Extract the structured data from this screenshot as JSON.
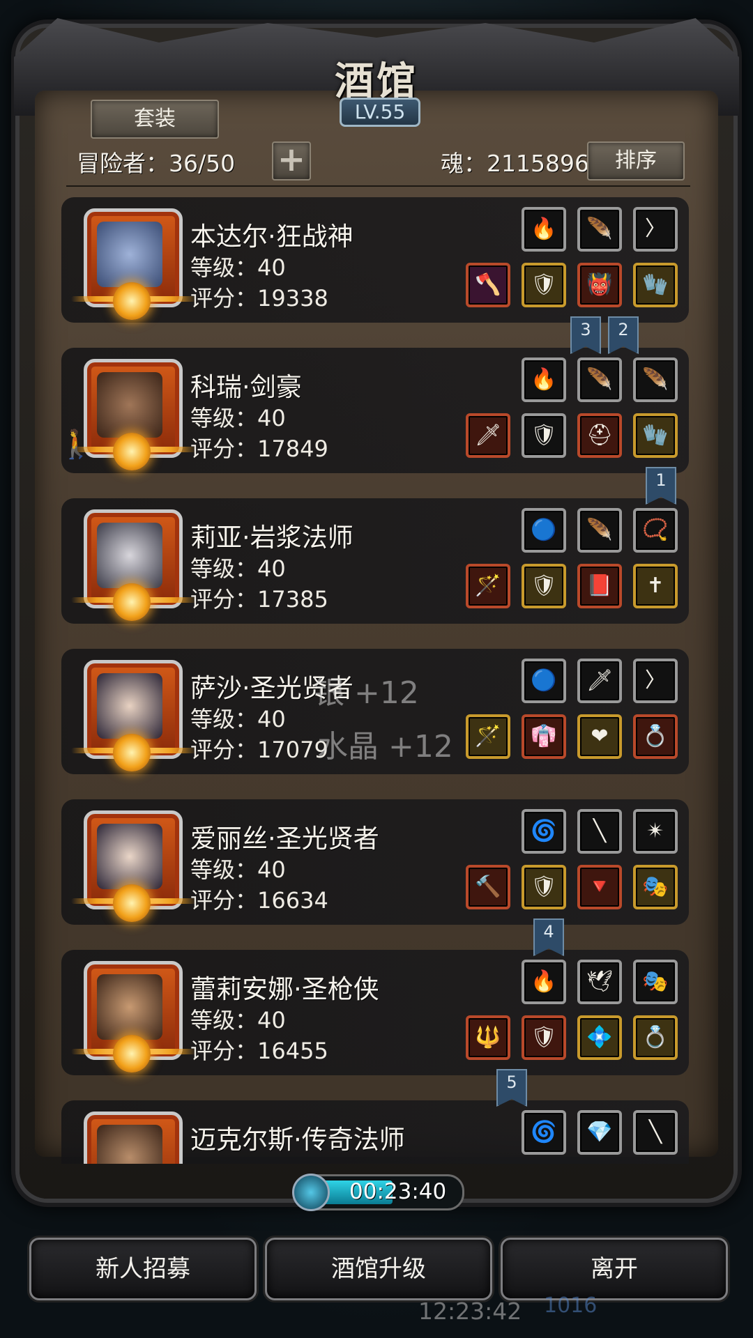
{
  "header": {
    "title": "酒馆",
    "level": "LV.55"
  },
  "toolbar": {
    "set_label": "套装",
    "adventurer_count": "冒险者：36/50",
    "plus_label": "+",
    "soul_value": "魂：2115896",
    "sort_label": "排序"
  },
  "heroes": [
    {
      "name": "本达尔·狂战神",
      "level": "等级：40",
      "score": "评分：19338"
    },
    {
      "name": "科瑞·剑豪",
      "level": "等级：40",
      "score": "评分：17849"
    },
    {
      "name": "莉亚·岩浆法师",
      "level": "等级：40",
      "score": "评分：17385"
    },
    {
      "name": "萨沙·圣光贤者",
      "level": "等级：40",
      "score": "评分：17079"
    },
    {
      "name": "爱丽丝·圣光贤者",
      "level": "等级：40",
      "score": "评分：16634"
    },
    {
      "name": "蕾莉安娜·圣枪侠",
      "level": "等级：40",
      "score": "评分：16455"
    },
    {
      "name": "迈克尔斯·传奇法师",
      "level": "",
      "score": ""
    }
  ],
  "bookmarks": [
    "3",
    "2",
    "1",
    "4",
    "5"
  ],
  "floating": {
    "silver": "银 +12",
    "crystal": "水晶 +12"
  },
  "timer": {
    "value": "00:23:40"
  },
  "buttons": {
    "recruit": "新人招募",
    "upgrade": "酒馆升级",
    "leave": "离开"
  },
  "background": {
    "clock": "12:23:42",
    "gems": "1016"
  },
  "colors": {
    "panel": "#4a3d30",
    "accent_timer": "#2fd3e6",
    "bookmark": "#2e4b68"
  }
}
